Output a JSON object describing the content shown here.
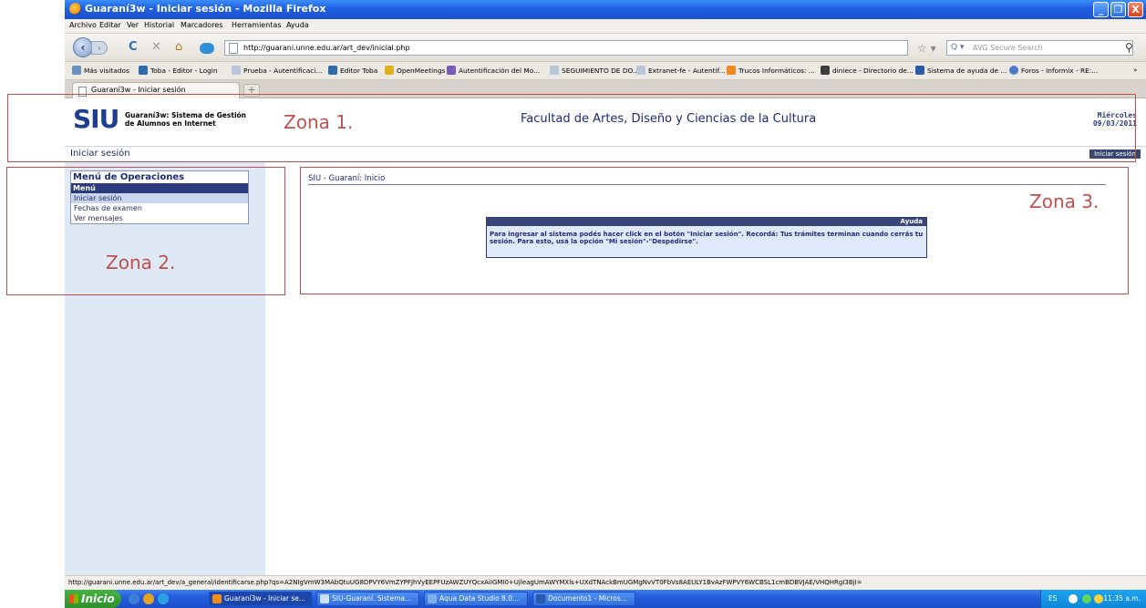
{
  "window": {
    "title": "Guaraní3w - Iniciar sesión - Mozilla Firefox",
    "controls": [
      "_",
      "❐",
      "X"
    ]
  },
  "menubar": [
    "Archivo",
    "Editar",
    "Ver",
    "Historial",
    "Marcadores",
    "Herramientas",
    "Ayuda"
  ],
  "navbar": {
    "url": "http://guarani.unne.edu.ar/art_dev/inicial.php",
    "search_placeholder": "AVG Secure Search"
  },
  "bookmarks": [
    {
      "label": "Más visitados",
      "color": "#6b8fbf"
    },
    {
      "label": "Toba - Editor - Login",
      "color": "#2d6ca8"
    },
    {
      "label": "Prueba - Autentificaci...",
      "color": "#b7c6da"
    },
    {
      "label": "Editor Toba",
      "color": "#2d6ca8"
    },
    {
      "label": "OpenMeetings",
      "color": "#e2b21c"
    },
    {
      "label": "Autentificación del Mo...",
      "color": "#7b5cb5"
    },
    {
      "label": "SEGUIMIENTO DE DO...",
      "color": "#b7c6da"
    },
    {
      "label": "Extranet-fe - Autentif...",
      "color": "#b7c6da"
    },
    {
      "label": "Trucos Informáticos: ...",
      "color": "#f08a1c"
    },
    {
      "label": "diniece - Directorio de...",
      "color": "#3d3d3d"
    },
    {
      "label": "Sistema de ayuda de ...",
      "color": "#2b5aa8"
    },
    {
      "label": "Foros - Informix - RE:...",
      "color": "#4d7bc9"
    }
  ],
  "tab": {
    "title": "Guaraní3w - Iniciar sesión",
    "new": "+"
  },
  "header": {
    "logo": "SIU",
    "subtitle_1": "Guaraní3w: Sistema de Gestión",
    "subtitle_2": "de Alumnos en Internet",
    "faculty": "Facultad de Artes, Diseño y Ciencias de la Cultura",
    "weekday": "Miércoles",
    "date": "09/03/2011"
  },
  "subbar": {
    "label": "Iniciar sesión",
    "button": "Iniciar sesión"
  },
  "menu": {
    "heading": "Menú de Operaciones",
    "section": "Menú",
    "items": [
      "Iniciar sesión",
      "Fechas de examen",
      "Ver mensajes"
    ]
  },
  "main": {
    "title": "SIU - Guaraní: Inicio",
    "help_heading": "Ayuda",
    "help_text": "Para ingresar al sistema podés hacer click en el botón \"Iniciar sesión\". Recordá: Tus trámites terminan cuando cerrás tu sesión. Para esto, usá la opción \"Mi sesión\"-\"Despedirse\"."
  },
  "status_url": "http://guarani.unne.edu.ar/art_dev/a_general/identificarse.php?qs=A2NIgVmW3MAbQtuUG8DPVY6VmZYPFJhVyEEPFUzAWZUYQcxAiIGMI0+UjleagUmAWYMXls+UXdTNAckBmUGMgNvVT0FbVs8AEULY1BvAzFWPVY6WCBSL1cmBDBVJAE/VHQHRgI3BjI=",
  "taskbar": {
    "start": "Inicio",
    "tasks": [
      "Guaraní3w - Iniciar se...",
      "SIU-Guaraní. Sistema...",
      "Aqua Data Studio 8.0...",
      "Documento1 - Micros..."
    ],
    "lang": "ES",
    "clock": "11:35 a.m."
  },
  "zones": [
    "Zona 1.",
    "Zona 2.",
    "Zona 3."
  ],
  "colors": {
    "zone": "#c0504d",
    "brand": "#1c3e8f",
    "menu_header": "#2a3a7d"
  }
}
